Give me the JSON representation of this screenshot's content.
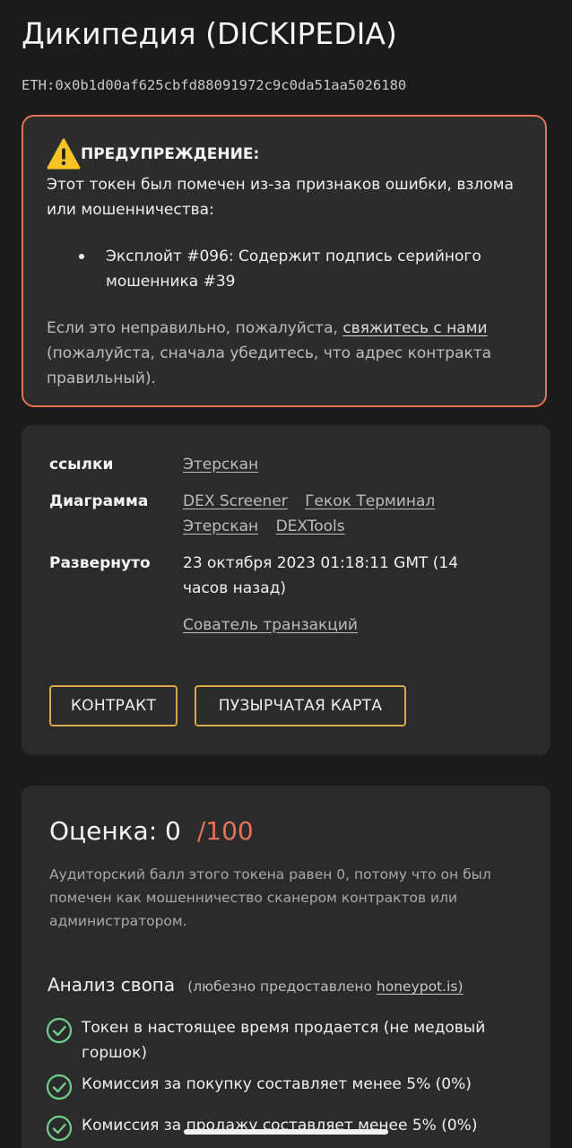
{
  "page": {
    "title": "Дикипедия (DICKIPEDIA)",
    "address": "ETH:0x0b1d00af625cbfd88091972c9c0da51aa5026180"
  },
  "warning": {
    "heading": "ПРЕДУПРЕЖДЕНИЕ:",
    "text": "Этот токен был помечен из-за признаков ошибки, взлома или мошенничества:",
    "bullet": "Эксплойт #096: Содержит подпись серийного мошенника #39",
    "footer_before": "Если это неправильно, пожалуйста, ",
    "footer_link": "свяжитесь с нами ",
    "footer_after": "(пожалуйста, сначала убедитесь, что адрес контракта правильный).",
    "icon": "warning-icon",
    "border_color": "#e2735a"
  },
  "info": {
    "links_label": "ссылки",
    "links": [
      "Этерскан"
    ],
    "chart_label": "Диаграмма",
    "chart_links": [
      "DEX Screener",
      "Гекок Терминал",
      "Этерскан",
      "DEXTools"
    ],
    "deployed_label": "Развернуто",
    "deployed_value": "23 октября 2023 01:18:11 GMT (14 часов назад)",
    "tx_link": "Сователь транзакций",
    "contract_button": "КОНТРАКТ",
    "bubblemap_button": "ПУЗЫРЧАТАЯ КАРТА",
    "button_border_color": "#d9a84a"
  },
  "score": {
    "label": "Оценка: 0",
    "max": "/100",
    "description": "Аудиторский балл этого токена равен 0, потому что он был помечен как мошенничество сканером контрактов или администратором.",
    "swap_title": "Анализ свопа",
    "swap_credit_before": "(любезно предоставлено ",
    "swap_credit_link": "honeypot.is)",
    "checks": [
      "Токен в настоящее время продается (не медовый горшок)",
      "Комиссия за покупку составляет менее 5% (0%)",
      "Комиссия за продажу составляет менее 5% (0%)"
    ],
    "check_color": "#6fcf8a",
    "max_color": "#e2735a"
  }
}
